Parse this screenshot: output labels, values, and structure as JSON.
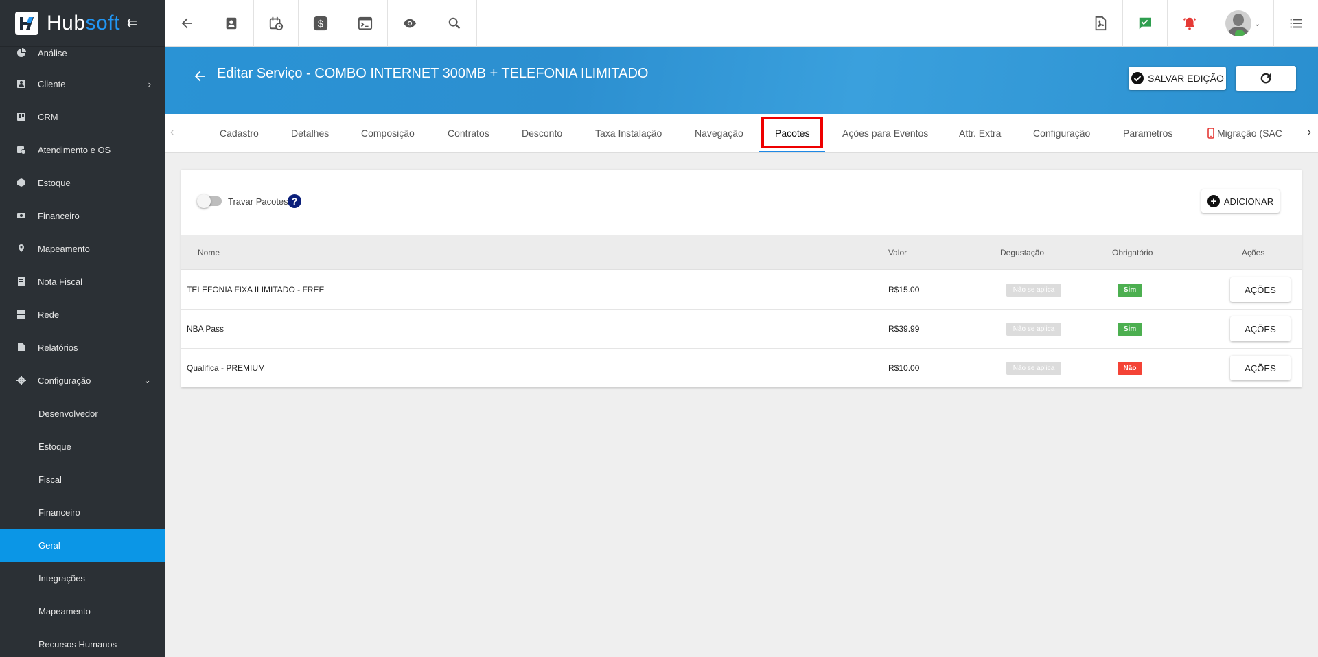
{
  "brand": {
    "name_part1": "Hub",
    "name_part2": "soft",
    "accent": "#2196f3"
  },
  "sidebar": {
    "items": [
      {
        "label": "Análise",
        "icon": "pie-chart-icon"
      },
      {
        "label": "Cliente",
        "icon": "contact-card-icon",
        "chevron": "›"
      },
      {
        "label": "CRM",
        "icon": "board-icon"
      },
      {
        "label": "Atendimento e OS",
        "icon": "calendar-clock-icon"
      },
      {
        "label": "Estoque",
        "icon": "box-icon"
      },
      {
        "label": "Financeiro",
        "icon": "money-icon"
      },
      {
        "label": "Mapeamento",
        "icon": "map-pin-icon"
      },
      {
        "label": "Nota Fiscal",
        "icon": "receipt-icon"
      },
      {
        "label": "Rede",
        "icon": "server-icon"
      },
      {
        "label": "Relatórios",
        "icon": "document-icon"
      },
      {
        "label": "Configuração",
        "icon": "gear-icon",
        "chevron": "⌄"
      }
    ],
    "subitems": [
      {
        "label": "Desenvolvedor"
      },
      {
        "label": "Estoque"
      },
      {
        "label": "Fiscal"
      },
      {
        "label": "Financeiro"
      },
      {
        "label": "Geral",
        "active": true
      },
      {
        "label": "Integrações"
      },
      {
        "label": "Mapeamento"
      },
      {
        "label": "Recursos Humanos"
      }
    ]
  },
  "header": {
    "title": "Editar Serviço - COMBO INTERNET 300MB + TELEFONIA ILIMITADO",
    "save_label": "SALVAR EDIÇÃO"
  },
  "tabs": [
    {
      "label": "Cadastro"
    },
    {
      "label": "Detalhes"
    },
    {
      "label": "Composição"
    },
    {
      "label": "Contratos"
    },
    {
      "label": "Desconto"
    },
    {
      "label": "Taxa Instalação"
    },
    {
      "label": "Navegação"
    },
    {
      "label": "Pacotes",
      "active": true
    },
    {
      "label": "Ações para Eventos"
    },
    {
      "label": "Attr. Extra"
    },
    {
      "label": "Configuração"
    },
    {
      "label": "Parametros"
    },
    {
      "label": "Migração (SAC"
    }
  ],
  "pacotes": {
    "toggle_label": "Travar Pacotes",
    "toggle_on": false,
    "help": "?",
    "add_label": "ADICIONAR",
    "columns": {
      "nome": "Nome",
      "valor": "Valor",
      "degustacao": "Degustação",
      "obrigatorio": "Obrigatório",
      "acoes": "Ações"
    },
    "rows": [
      {
        "nome": "TELEFONIA FIXA ILIMITADO - FREE",
        "valor": "R$15.00",
        "degustacao": "Não se aplica",
        "obrigatorio": "Sim",
        "obrigatorio_color": "#4caf50",
        "acoes": "AÇÕES"
      },
      {
        "nome": "NBA Pass",
        "valor": "R$39.99",
        "degustacao": "Não se aplica",
        "obrigatorio": "Sim",
        "obrigatorio_color": "#4caf50",
        "acoes": "AÇÕES"
      },
      {
        "nome": "Qualifica - PREMIUM",
        "valor": "R$10.00",
        "degustacao": "Não se aplica",
        "obrigatorio": "Não",
        "obrigatorio_color": "#f44336",
        "acoes": "AÇÕES"
      }
    ]
  }
}
